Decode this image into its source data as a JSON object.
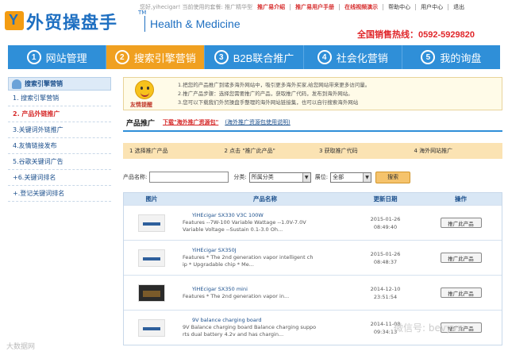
{
  "header": {
    "logo_text": "外贸操盘手",
    "tm": "TM",
    "subtitle": "Health & Medicine",
    "welcome": "您好,yihecigar! 当前使用的套餐: 推广精华型",
    "links": [
      {
        "label": "推广易介绍",
        "style": "hl"
      },
      {
        "label": "推广易用户手册",
        "style": "hl"
      },
      {
        "label": "在线视频演示",
        "style": "hl"
      },
      {
        "label": "帮助中心",
        "style": "plain"
      },
      {
        "label": "用户中心",
        "style": "plain"
      },
      {
        "label": "退出",
        "style": "plain"
      }
    ],
    "hotline": "全国销售热线：0592-5929820"
  },
  "nav": [
    {
      "num": "1",
      "label": "网站管理"
    },
    {
      "num": "2",
      "label": "搜索引擎营销",
      "active": true
    },
    {
      "num": "3",
      "label": "B2B联合推广"
    },
    {
      "num": "4",
      "label": "社会化营销"
    },
    {
      "num": "5",
      "label": "我的询盘"
    }
  ],
  "sidebar": {
    "title": "搜索引擎营销",
    "items": [
      {
        "label": "1. 搜索引擎营销"
      },
      {
        "label": "2. 产品外链推广",
        "active": true
      },
      {
        "label": "3.关键词外链推广"
      },
      {
        "label": "4.友情链接发布"
      },
      {
        "label": "5.谷歌关键词广告"
      },
      {
        "label": "+6.关键词排名"
      },
      {
        "label": "+.登记关键词排名"
      }
    ]
  },
  "notice": {
    "label": "友情提醒",
    "lines": [
      "1.把您的产品推广到诸多海外网站中，吸引更多海外买家,给您网站带来更多访问量。",
      "2.推广产品步骤：选择您需要推广的产品，获取推广代码，发布到海外网站。",
      "3.您可以下载我们外贸操盘手整理的海外网站链接集，也可以自行搜索海外网站"
    ]
  },
  "section": {
    "title": "产品推广",
    "download_link": "下载\"海外推广资源包\"",
    "help_link": "(海外推广资源包使用说明)"
  },
  "steps": [
    "1 选择推广产品",
    "2 点击 \"推广此产品\"",
    "3 获取推广代码",
    "4 海外网站推广"
  ],
  "filters": {
    "name_label": "产品名称:",
    "category_label": "分类:",
    "category_value": "所属分类",
    "display_label": "展位:",
    "display_value": "全部",
    "search_label": "搜索"
  },
  "table": {
    "headers": [
      "图片",
      "产品名称",
      "更新日期",
      "操作"
    ],
    "rows": [
      {
        "name": "YiHEcigar SX330 V3C 100W",
        "desc1": "Features --7W-100 Variable Wattage --1.0V-7.0V",
        "desc2": "Variable Voltage --Sustain 0.1-3.0 Oh...",
        "date": "2015-01-26",
        "time": "08:49:40",
        "action": "推广此产品"
      },
      {
        "name": "YiHEcigar SX350J",
        "desc1": "Features * The 2nd generation vapor intelligent ch",
        "desc2": "ip * Upgradable chip * Me...",
        "date": "2015-01-26",
        "time": "08:48:37",
        "action": "推广此产品"
      },
      {
        "name": "YiHEcigar SX350 mini",
        "desc1": "Features * The 2nd generation vapor in...",
        "desc2": "",
        "date": "2014-12-10",
        "time": "23:51:54",
        "action": "推广此产品"
      },
      {
        "name": "9V balance charging board",
        "desc1": "9V Balance charging board Balance charging suppo",
        "desc2": "rts dual battery 4.2v and has chargin...",
        "date": "2014-11-08",
        "time": "09:34:13",
        "action": "推广此产品"
      }
    ]
  },
  "watermarks": {
    "left": "大数据网",
    "right": "微信号: bevyvw"
  }
}
